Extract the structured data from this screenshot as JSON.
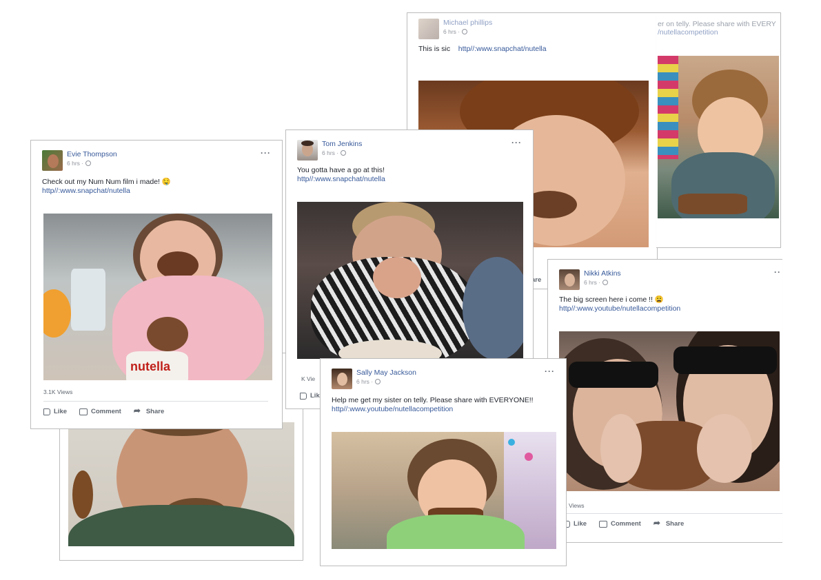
{
  "posts": {
    "michael": {
      "name": "Michael phillips",
      "time": "6 hrs ·",
      "message": "This is sic",
      "link": "http//:www.snapchat/nutella",
      "share_fragment": "are"
    },
    "back_right": {
      "message_fragment": "er on telly. Please share with EVERY",
      "link_fragment": "/nutellacompetition"
    },
    "evie": {
      "name": "Evie Thompson",
      "time": "6 hrs ·",
      "message": "Check out my Num Num film i made! 🤤",
      "link": "http//:www.snapchat/nutella",
      "views": "3.1K Views",
      "actions": [
        "Like",
        "Comment",
        "Share"
      ]
    },
    "tom": {
      "name": "Tom Jenkins",
      "time": "6 hrs ·",
      "message": "You gotta have a go at this!",
      "link": "http//:www.snapchat/nutella",
      "views_fragment": "K Vie",
      "like_fragment": "Like"
    },
    "nikki": {
      "name": "Nikki Atkins",
      "time": "6 hrs ·",
      "message": "The big screen here i come !! 😩",
      "link": "http//:www.youtube/nutellacompetition",
      "views_fragment": "K Views",
      "actions": [
        "Like",
        "Comment",
        "Share"
      ]
    },
    "sally": {
      "name": "Sally May Jackson",
      "time": "6 hrs ·",
      "message": "Help me get my sister on telly. Please share with EVERYONE!!",
      "link": "http//:www.youtube/nutellacompetition"
    }
  },
  "icons": {
    "more": "more-options-icon",
    "globe": "globe-icon",
    "like": "thumbs-up-icon",
    "comment": "comment-icon",
    "share": "share-arrow-icon"
  },
  "colors": {
    "link": "#365899",
    "meta": "#90949c",
    "border": "#bdbdbd"
  }
}
